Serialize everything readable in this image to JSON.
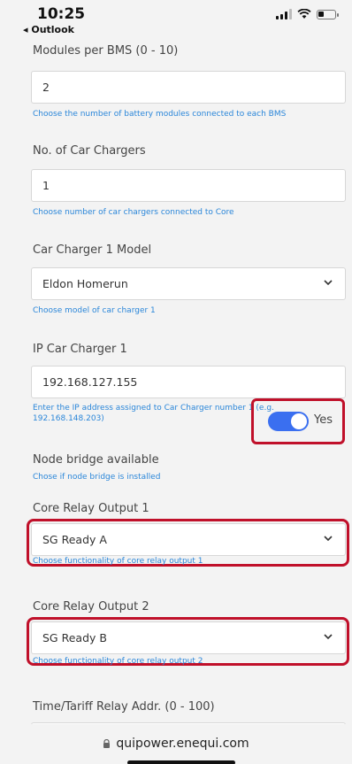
{
  "status": {
    "time": "10:25",
    "back_label": "◂ Outlook"
  },
  "form": {
    "modules_per_bms": {
      "label": "Modules per BMS (0 - 10)",
      "value": "2",
      "help": "Choose the number of battery modules connected to each BMS"
    },
    "car_chargers": {
      "label": "No. of Car Chargers",
      "value": "1",
      "help": "Choose number of car chargers connected to Core"
    },
    "charger_model": {
      "label": "Car Charger 1 Model",
      "value": "Eldon Homerun",
      "help": "Choose model of car charger 1"
    },
    "ip_charger": {
      "label": "IP Car Charger 1",
      "value": "192.168.127.155",
      "help": "Enter the IP address assigned to Car Charger number 1 (e.g. 192.168.148.203)"
    },
    "node_bridge": {
      "label": "Node bridge available",
      "help": "Chose if node bridge is installed",
      "toggle_label": "Yes",
      "enabled": true
    },
    "relay1": {
      "label": "Core Relay Output 1",
      "value": "SG Ready A",
      "help": "Choose functionality of core relay output 1"
    },
    "relay2": {
      "label": "Core Relay Output 2",
      "value": "SG Ready B",
      "help": "Choose functionality of core relay output 2"
    },
    "tariff_relay": {
      "label": "Time/Tariff Relay Addr. (0 - 100)"
    }
  },
  "browser": {
    "url": "quipower.enequi.com"
  },
  "colors": {
    "accent": "#3a6ff0",
    "help": "#2a86d9",
    "highlight": "#c0102a"
  }
}
